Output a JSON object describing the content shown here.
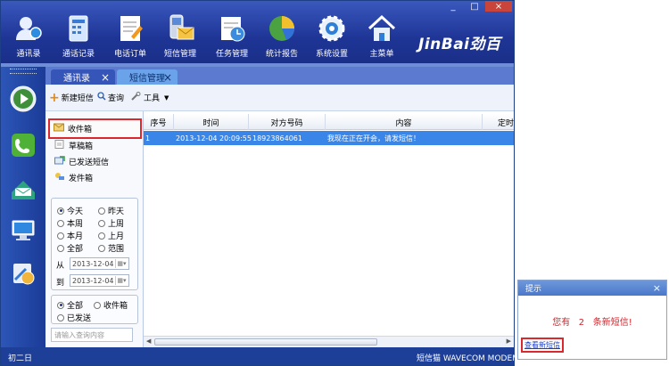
{
  "toolbar_top": {
    "buttons": [
      {
        "id": "contacts",
        "label": "通讯录",
        "icon": "user-group-icon"
      },
      {
        "id": "calllog",
        "label": "通话记录",
        "icon": "call-log-icon"
      },
      {
        "id": "order",
        "label": "电话订单",
        "icon": "order-form-icon"
      },
      {
        "id": "sms",
        "label": "短信管理",
        "icon": "sms-phone-icon"
      },
      {
        "id": "task",
        "label": "任务管理",
        "icon": "task-calendar-icon"
      },
      {
        "id": "report",
        "label": "统计报告",
        "icon": "pie-chart-icon"
      },
      {
        "id": "settings",
        "label": "系统设置",
        "icon": "gear-icon"
      },
      {
        "id": "home",
        "label": "主菜单",
        "icon": "home-icon"
      }
    ],
    "brand": "JinBai劲百"
  },
  "window_controls": {
    "minimize": "_",
    "maximize": "□",
    "close": "×"
  },
  "tabs": [
    {
      "label": "通讯录",
      "close": "×"
    },
    {
      "label": "短信管理",
      "close": "×"
    }
  ],
  "actions": {
    "new_sms": "新建短信",
    "query": "查询",
    "tools": "工具"
  },
  "folders": {
    "inbox": "收件箱",
    "draft": "草稿箱",
    "sent": "已发送短信",
    "outbox": "发件箱"
  },
  "date_filter": {
    "today": "今天",
    "yesterday": "昨天",
    "this_week": "本周",
    "last_week": "上周",
    "this_month": "本月",
    "last_month": "上月",
    "all": "全部",
    "range": "范围",
    "from_label": "从",
    "to_label": "到",
    "from_value": "2013-12-04",
    "to_value": "2013-12-04"
  },
  "type_filter": {
    "all": "全部",
    "inbox": "收件箱",
    "sent": "已发送"
  },
  "search": {
    "placeholder": "请输入查询内容"
  },
  "table": {
    "columns": [
      "序号",
      "时间",
      "对方号码",
      "内容",
      "定时"
    ],
    "rows": [
      {
        "seq": "1",
        "time": "2013-12-04 20:09:55",
        "number": "18923864061",
        "content": "我现在正在开会，请发短信！"
      }
    ]
  },
  "statusbar": {
    "lunar_date": "初二日",
    "status_text": "短信猫  WAVECOM MODEM 初始"
  },
  "popup": {
    "title": "提示",
    "close": "×",
    "msg_prefix": "您有",
    "msg_count": "2",
    "msg_suffix": "条新短信!",
    "view_link": "查看新短信"
  }
}
